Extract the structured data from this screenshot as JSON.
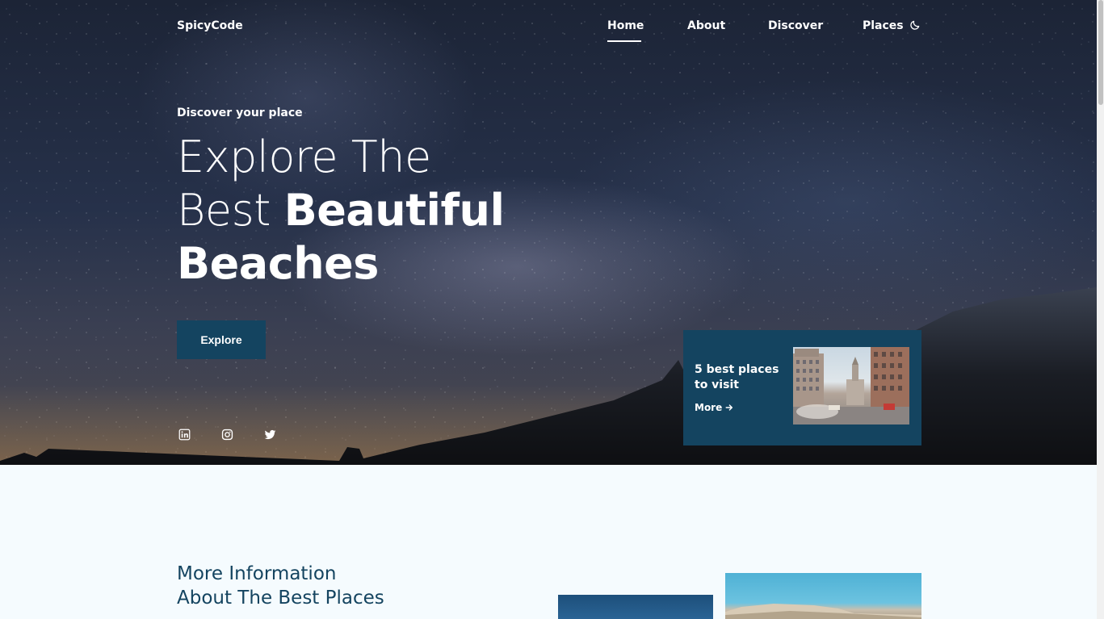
{
  "nav": {
    "logo": "SpicyCode",
    "links": [
      "Home",
      "About",
      "Discover",
      "Places"
    ],
    "active": "Home",
    "theme_icon": "moon-icon"
  },
  "hero": {
    "subtitle": "Discover your place",
    "title_line1": "Explore The",
    "title_line2_light": "Best ",
    "title_line2_bold": "Beautiful",
    "title_line3_bold": "Beaches",
    "button": "Explore",
    "social_icons": [
      "linkedin-icon",
      "instagram-icon",
      "twitter-icon"
    ]
  },
  "card": {
    "title": "5 best places to visit",
    "more": "More"
  },
  "info": {
    "title_line1": "More Information",
    "title_line2": "About The Best Places"
  },
  "colors": {
    "accent": "#144460",
    "background": "#f5fbfe"
  }
}
